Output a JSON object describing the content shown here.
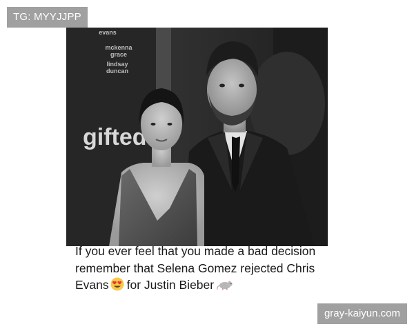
{
  "badge": {
    "text": "TG: MYYJJPP"
  },
  "photo": {
    "backdrop_text": {
      "line1": "evans",
      "line2": "mckenna",
      "line3": "grace",
      "line4": "lindsay",
      "line5": "duncan",
      "logo": "gifted"
    }
  },
  "caption": {
    "line1": "If you ever feel that you made a bad decision",
    "line2": "remember that Selena Gomez rejected Chris",
    "line3_part1": "Evans",
    "line3_part2": "for Justin Bieber"
  },
  "icons": {
    "heart_eyes": "heart-eyes-emoji",
    "rat": "rat-emoji"
  },
  "watermark": {
    "text": "gray-kaiyun.com"
  }
}
